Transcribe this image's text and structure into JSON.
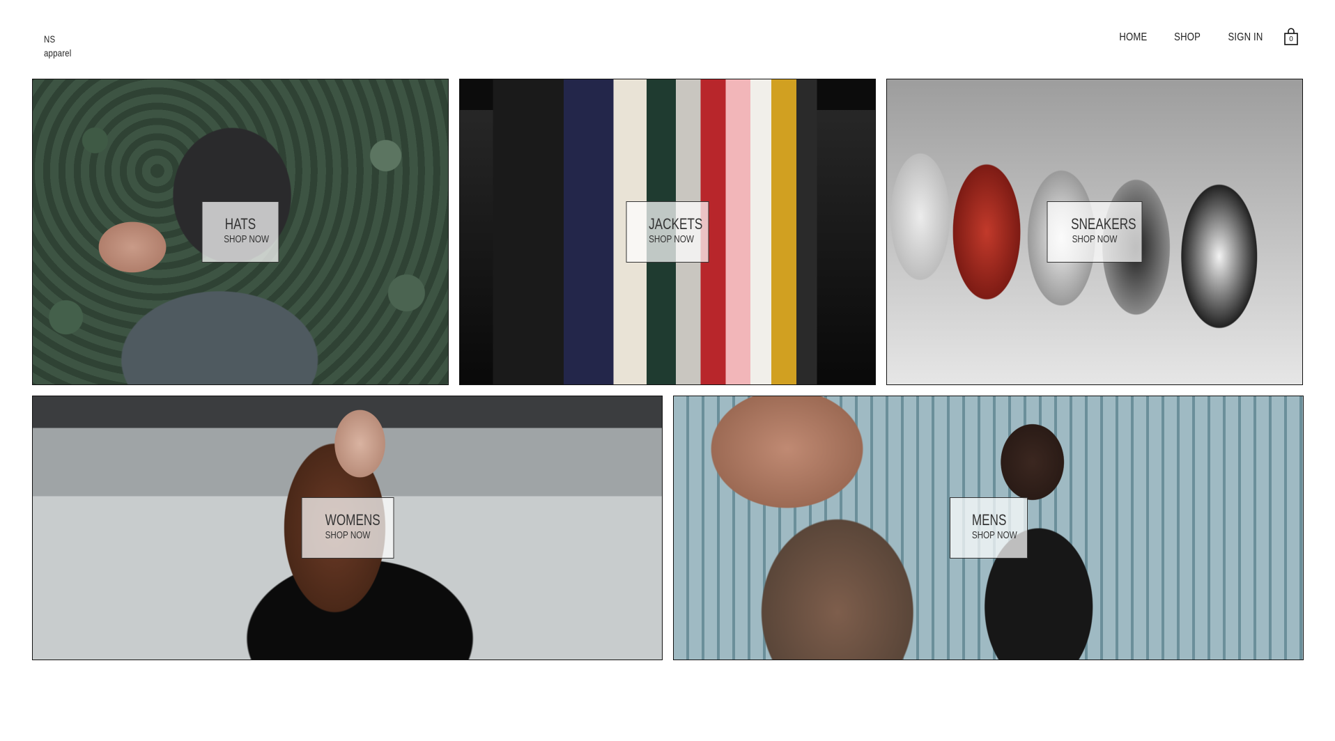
{
  "brand": {
    "line1": "NS",
    "line2": "apparel"
  },
  "nav": {
    "home": "HOME",
    "shop": "SHOP",
    "sign_in": "SIGN IN",
    "cart_count": "0"
  },
  "categories": [
    {
      "title": "HATS",
      "cta": "SHOP NOW"
    },
    {
      "title": "JACKETS",
      "cta": "SHOP NOW"
    },
    {
      "title": "SNEAKERS",
      "cta": "SHOP NOW"
    },
    {
      "title": "WOMENS",
      "cta": "SHOP NOW"
    },
    {
      "title": "MENS",
      "cta": "SHOP NOW"
    }
  ]
}
